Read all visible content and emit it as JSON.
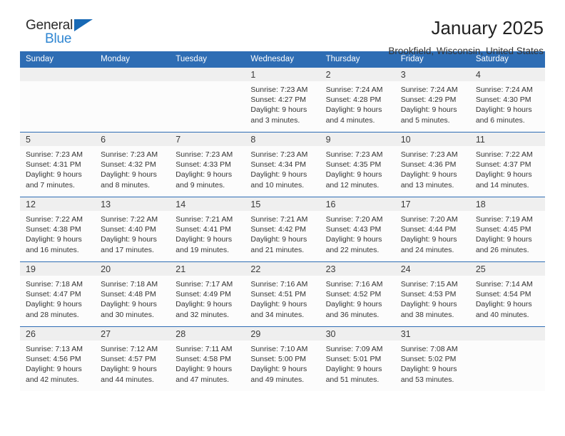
{
  "logo": {
    "primary_text": "General",
    "secondary_text": "Blue",
    "primary_color": "#2b2b2b",
    "secondary_color": "#2f86d2",
    "triangle_color": "#1769b5"
  },
  "header": {
    "title": "January 2025",
    "subtitle": "Brookfield, Wisconsin, United States"
  },
  "colors": {
    "header_bg": "#2E6DB4",
    "header_text": "#FFFFFF",
    "daynum_bg": "#EFEFEF",
    "cell_bg": "#FCFCFC",
    "text": "#333333"
  },
  "weekday_headers": [
    "Sunday",
    "Monday",
    "Tuesday",
    "Wednesday",
    "Thursday",
    "Friday",
    "Saturday"
  ],
  "labels": {
    "sunrise": "Sunrise:",
    "sunset": "Sunset:",
    "daylight": "Daylight:"
  },
  "weeks": [
    [
      {
        "empty": true
      },
      {
        "empty": true
      },
      {
        "empty": true
      },
      {
        "day": "1",
        "sunrise": "Sunrise: 7:23 AM",
        "sunset": "Sunset: 4:27 PM",
        "daylight": "Daylight: 9 hours and 3 minutes."
      },
      {
        "day": "2",
        "sunrise": "Sunrise: 7:24 AM",
        "sunset": "Sunset: 4:28 PM",
        "daylight": "Daylight: 9 hours and 4 minutes."
      },
      {
        "day": "3",
        "sunrise": "Sunrise: 7:24 AM",
        "sunset": "Sunset: 4:29 PM",
        "daylight": "Daylight: 9 hours and 5 minutes."
      },
      {
        "day": "4",
        "sunrise": "Sunrise: 7:24 AM",
        "sunset": "Sunset: 4:30 PM",
        "daylight": "Daylight: 9 hours and 6 minutes."
      }
    ],
    [
      {
        "day": "5",
        "sunrise": "Sunrise: 7:23 AM",
        "sunset": "Sunset: 4:31 PM",
        "daylight": "Daylight: 9 hours and 7 minutes."
      },
      {
        "day": "6",
        "sunrise": "Sunrise: 7:23 AM",
        "sunset": "Sunset: 4:32 PM",
        "daylight": "Daylight: 9 hours and 8 minutes."
      },
      {
        "day": "7",
        "sunrise": "Sunrise: 7:23 AM",
        "sunset": "Sunset: 4:33 PM",
        "daylight": "Daylight: 9 hours and 9 minutes."
      },
      {
        "day": "8",
        "sunrise": "Sunrise: 7:23 AM",
        "sunset": "Sunset: 4:34 PM",
        "daylight": "Daylight: 9 hours and 10 minutes."
      },
      {
        "day": "9",
        "sunrise": "Sunrise: 7:23 AM",
        "sunset": "Sunset: 4:35 PM",
        "daylight": "Daylight: 9 hours and 12 minutes."
      },
      {
        "day": "10",
        "sunrise": "Sunrise: 7:23 AM",
        "sunset": "Sunset: 4:36 PM",
        "daylight": "Daylight: 9 hours and 13 minutes."
      },
      {
        "day": "11",
        "sunrise": "Sunrise: 7:22 AM",
        "sunset": "Sunset: 4:37 PM",
        "daylight": "Daylight: 9 hours and 14 minutes."
      }
    ],
    [
      {
        "day": "12",
        "sunrise": "Sunrise: 7:22 AM",
        "sunset": "Sunset: 4:38 PM",
        "daylight": "Daylight: 9 hours and 16 minutes."
      },
      {
        "day": "13",
        "sunrise": "Sunrise: 7:22 AM",
        "sunset": "Sunset: 4:40 PM",
        "daylight": "Daylight: 9 hours and 17 minutes."
      },
      {
        "day": "14",
        "sunrise": "Sunrise: 7:21 AM",
        "sunset": "Sunset: 4:41 PM",
        "daylight": "Daylight: 9 hours and 19 minutes."
      },
      {
        "day": "15",
        "sunrise": "Sunrise: 7:21 AM",
        "sunset": "Sunset: 4:42 PM",
        "daylight": "Daylight: 9 hours and 21 minutes."
      },
      {
        "day": "16",
        "sunrise": "Sunrise: 7:20 AM",
        "sunset": "Sunset: 4:43 PM",
        "daylight": "Daylight: 9 hours and 22 minutes."
      },
      {
        "day": "17",
        "sunrise": "Sunrise: 7:20 AM",
        "sunset": "Sunset: 4:44 PM",
        "daylight": "Daylight: 9 hours and 24 minutes."
      },
      {
        "day": "18",
        "sunrise": "Sunrise: 7:19 AM",
        "sunset": "Sunset: 4:45 PM",
        "daylight": "Daylight: 9 hours and 26 minutes."
      }
    ],
    [
      {
        "day": "19",
        "sunrise": "Sunrise: 7:18 AM",
        "sunset": "Sunset: 4:47 PM",
        "daylight": "Daylight: 9 hours and 28 minutes."
      },
      {
        "day": "20",
        "sunrise": "Sunrise: 7:18 AM",
        "sunset": "Sunset: 4:48 PM",
        "daylight": "Daylight: 9 hours and 30 minutes."
      },
      {
        "day": "21",
        "sunrise": "Sunrise: 7:17 AM",
        "sunset": "Sunset: 4:49 PM",
        "daylight": "Daylight: 9 hours and 32 minutes."
      },
      {
        "day": "22",
        "sunrise": "Sunrise: 7:16 AM",
        "sunset": "Sunset: 4:51 PM",
        "daylight": "Daylight: 9 hours and 34 minutes."
      },
      {
        "day": "23",
        "sunrise": "Sunrise: 7:16 AM",
        "sunset": "Sunset: 4:52 PM",
        "daylight": "Daylight: 9 hours and 36 minutes."
      },
      {
        "day": "24",
        "sunrise": "Sunrise: 7:15 AM",
        "sunset": "Sunset: 4:53 PM",
        "daylight": "Daylight: 9 hours and 38 minutes."
      },
      {
        "day": "25",
        "sunrise": "Sunrise: 7:14 AM",
        "sunset": "Sunset: 4:54 PM",
        "daylight": "Daylight: 9 hours and 40 minutes."
      }
    ],
    [
      {
        "day": "26",
        "sunrise": "Sunrise: 7:13 AM",
        "sunset": "Sunset: 4:56 PM",
        "daylight": "Daylight: 9 hours and 42 minutes."
      },
      {
        "day": "27",
        "sunrise": "Sunrise: 7:12 AM",
        "sunset": "Sunset: 4:57 PM",
        "daylight": "Daylight: 9 hours and 44 minutes."
      },
      {
        "day": "28",
        "sunrise": "Sunrise: 7:11 AM",
        "sunset": "Sunset: 4:58 PM",
        "daylight": "Daylight: 9 hours and 47 minutes."
      },
      {
        "day": "29",
        "sunrise": "Sunrise: 7:10 AM",
        "sunset": "Sunset: 5:00 PM",
        "daylight": "Daylight: 9 hours and 49 minutes."
      },
      {
        "day": "30",
        "sunrise": "Sunrise: 7:09 AM",
        "sunset": "Sunset: 5:01 PM",
        "daylight": "Daylight: 9 hours and 51 minutes."
      },
      {
        "day": "31",
        "sunrise": "Sunrise: 7:08 AM",
        "sunset": "Sunset: 5:02 PM",
        "daylight": "Daylight: 9 hours and 53 minutes."
      },
      {
        "empty": true
      }
    ]
  ]
}
